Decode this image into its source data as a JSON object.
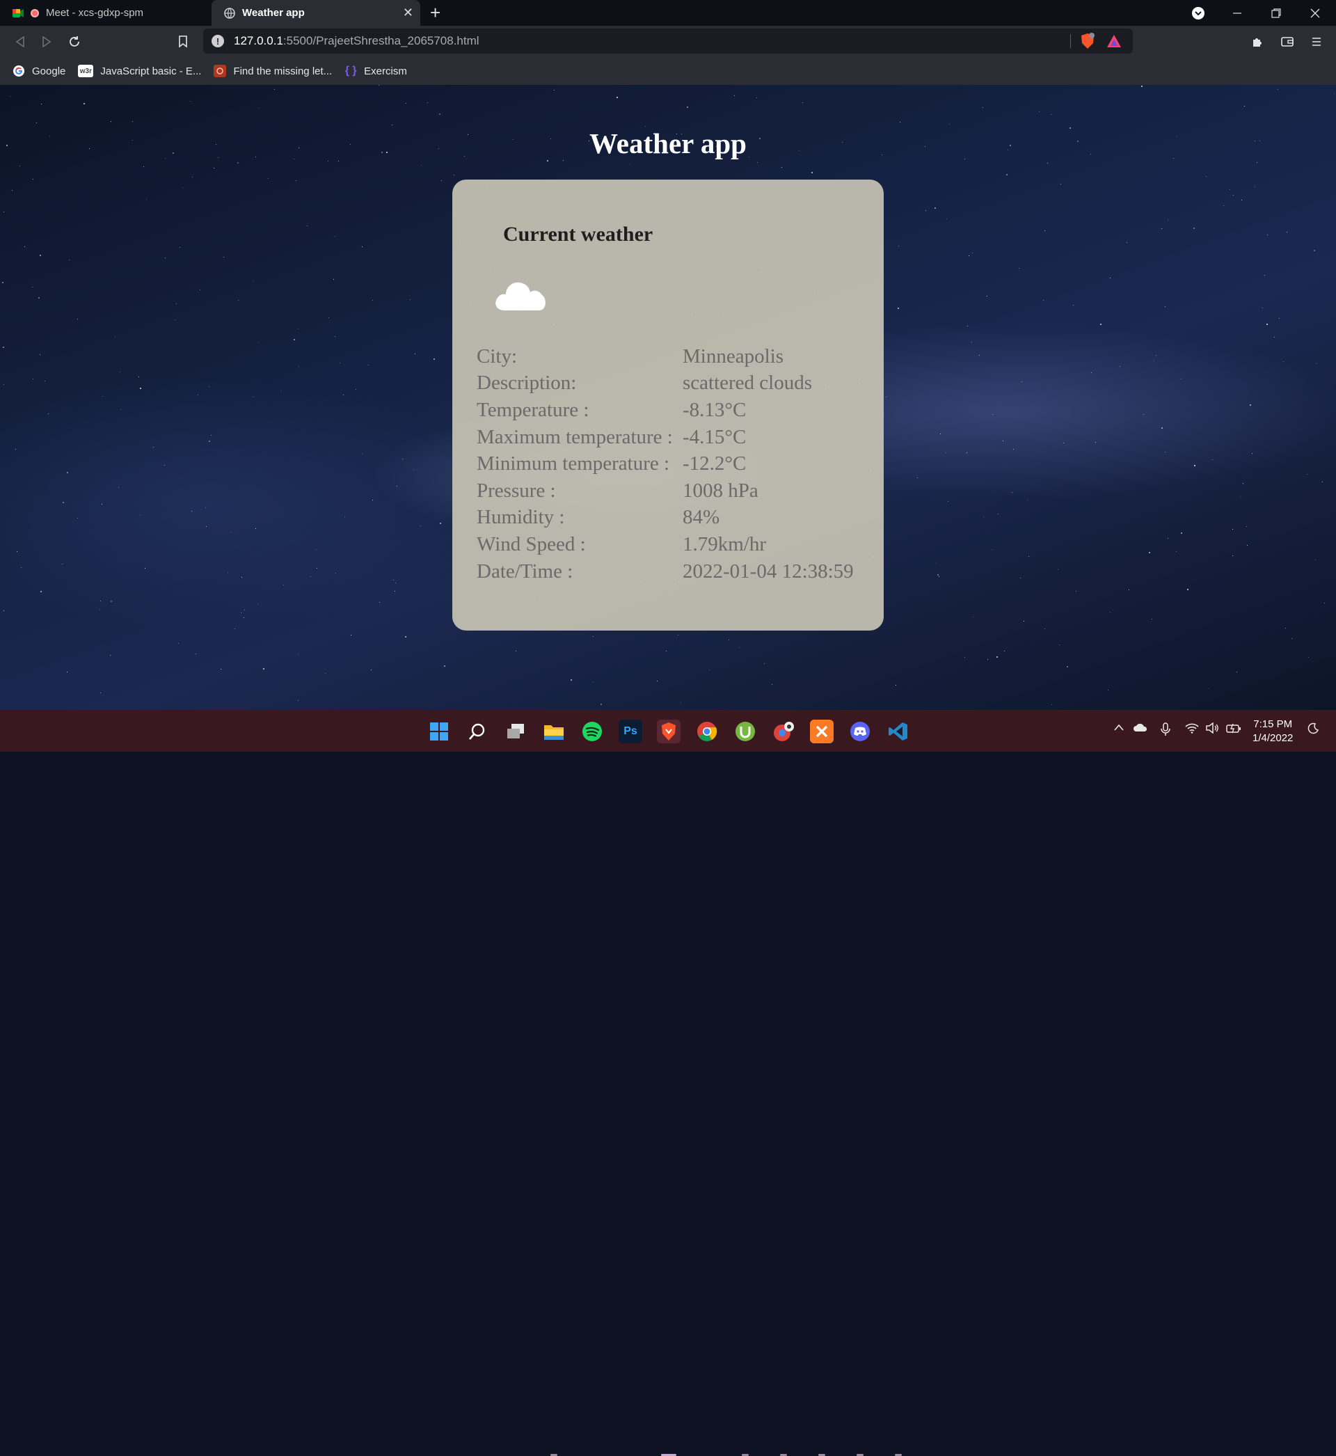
{
  "browser": {
    "tabs": [
      {
        "title": "Meet - xcs-gdxp-spm",
        "active": false
      },
      {
        "title": "Weather app",
        "active": true
      }
    ],
    "url": {
      "host": "127.0.0.1",
      "path": ":5500/PrajeetShrestha_2065708.html"
    },
    "bookmarks": [
      {
        "label": "Google",
        "icon": "google-icon"
      },
      {
        "label": "JavaScript basic - E...",
        "icon": "w3r-icon"
      },
      {
        "label": "Find the missing let...",
        "icon": "codewars-icon"
      },
      {
        "label": "Exercism",
        "icon": "exercism-icon"
      }
    ]
  },
  "page": {
    "title": "Weather app",
    "card": {
      "heading": "Current weather",
      "icon": "cloud-icon",
      "rows": [
        {
          "label": "City:",
          "value": "Minneapolis"
        },
        {
          "label": "Description:",
          "value": "scattered clouds"
        },
        {
          "label": "Temperature :",
          "value": "-8.13°C"
        },
        {
          "label": "Maximum temperature :",
          "value": "-4.15°C"
        },
        {
          "label": "Minimum temperature :",
          "value": "-12.2°C"
        },
        {
          "label": "Pressure :",
          "value": "1008 hPa"
        },
        {
          "label": "Humidity :",
          "value": "84%"
        },
        {
          "label": "Wind Speed :",
          "value": "1.79km/hr"
        },
        {
          "label": "Date/Time :",
          "value": "2022-01-04 12:38:59"
        }
      ]
    }
  },
  "taskbar": {
    "clock": {
      "time": "7:15 PM",
      "date": "1/4/2022"
    },
    "apps": [
      "windows-start-icon",
      "search-icon",
      "task-view-icon",
      "file-explorer-icon",
      "spotify-icon",
      "photoshop-icon",
      "brave-icon",
      "chrome-icon",
      "utorrent-icon",
      "chrome-profile-icon",
      "xampp-icon",
      "discord-icon",
      "vscode-icon"
    ],
    "photoshop_label": "Ps"
  },
  "colors": {
    "card_background": "#c8c4b4",
    "taskbar": "#3a1820",
    "tab_active": "#2a2d33"
  }
}
